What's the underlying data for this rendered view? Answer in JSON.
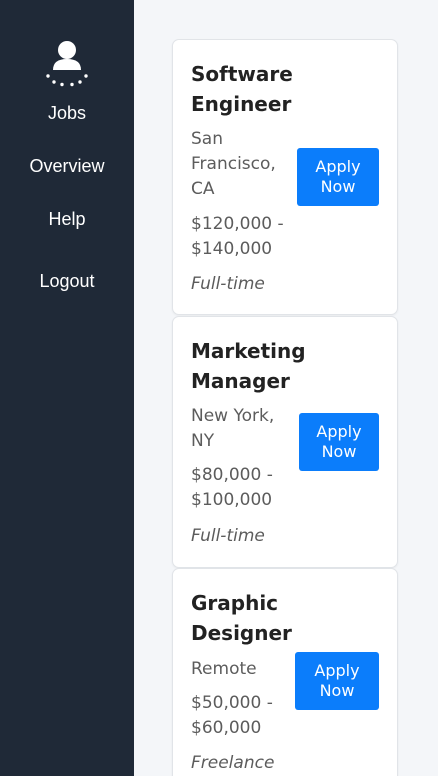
{
  "sidebar": {
    "avatar_icon": "user-avatar-icon",
    "items": [
      {
        "label": "Jobs"
      },
      {
        "label": "Overview"
      },
      {
        "label": "Help"
      },
      {
        "label": "Logout"
      }
    ]
  },
  "jobs": [
    {
      "title_line1": "Software",
      "title_line2": "Engineer",
      "location_line1": "San",
      "location_line2": "Francisco,",
      "location_line3": "CA",
      "salary_line1": "$120,000 -",
      "salary_line2": "$140,000",
      "type": "Full-time",
      "apply_line1": "Apply",
      "apply_line2": "Now"
    },
    {
      "title_line1": "Marketing",
      "title_line2": "Manager",
      "location_line1": "New York,",
      "location_line2": "NY",
      "salary_line1": "$80,000 -",
      "salary_line2": "$100,000",
      "type": "Full-time",
      "apply_line1": "Apply",
      "apply_line2": "Now"
    },
    {
      "title_line1": "Graphic",
      "title_line2": "Designer",
      "location_line1": "Remote",
      "salary_line1": "$50,000 -",
      "salary_line2": "$60,000",
      "type": "Freelance",
      "apply_line1": "Apply",
      "apply_line2": "Now"
    }
  ],
  "colors": {
    "sidebar_bg": "#1f2937",
    "accent": "#0b7dfb",
    "page_bg": "#f4f6f9"
  }
}
